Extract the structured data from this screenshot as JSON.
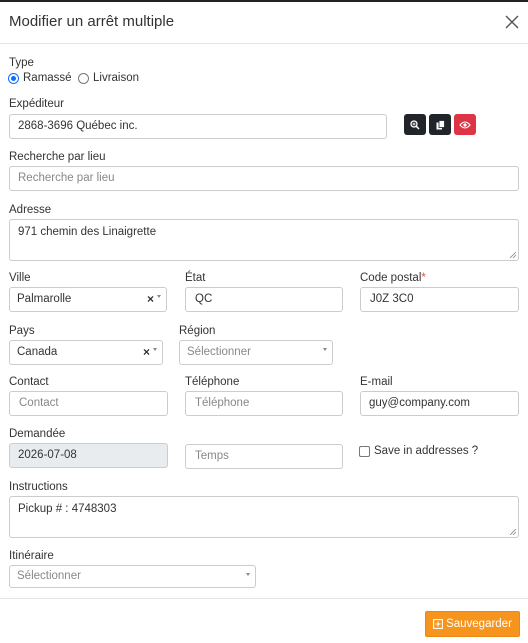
{
  "modal": {
    "title": "Modifier un arrêt multiple"
  },
  "type": {
    "label": "Type",
    "options": [
      "Ramassé",
      "Livraison"
    ],
    "selected": "Ramassé"
  },
  "expediteur": {
    "label": "Expéditeur",
    "value": "2868-3696 Québec inc.",
    "buttons": [
      "zoom-search-icon",
      "copy-icon",
      "eye-icon"
    ]
  },
  "recherche": {
    "label": "Recherche par lieu",
    "placeholder": "Recherche par lieu"
  },
  "adresse": {
    "label": "Adresse",
    "value": "971 chemin des Linaigrette"
  },
  "ville": {
    "label": "Ville",
    "value": "Palmarolle"
  },
  "etat": {
    "label": "État",
    "value": "QC"
  },
  "code_postal": {
    "label": "Code postal",
    "required": "*",
    "value": "J0Z 3C0"
  },
  "pays": {
    "label": "Pays",
    "value": "Canada"
  },
  "region": {
    "label": "Région",
    "placeholder": "Sélectionner"
  },
  "contact": {
    "label": "Contact",
    "placeholder": "Contact"
  },
  "telephone": {
    "label": "Téléphone",
    "placeholder": "Téléphone"
  },
  "email": {
    "label": "E-mail",
    "value": "guy@company.com"
  },
  "demandee": {
    "label": "Demandée",
    "value": "2026-07-08"
  },
  "temps": {
    "placeholder": "Temps"
  },
  "save_address": {
    "label": "Save in addresses ?"
  },
  "instructions": {
    "label": "Instructions",
    "value": "Pickup # : 4748303"
  },
  "itineraire": {
    "label": "Itinéraire",
    "placeholder": "Sélectionner"
  },
  "footer": {
    "save_label": "Sauvegarder"
  },
  "colors": {
    "danger": "#dc3545",
    "dark": "#212529",
    "accent": "#f7941d",
    "radio": "#0d6efd"
  }
}
